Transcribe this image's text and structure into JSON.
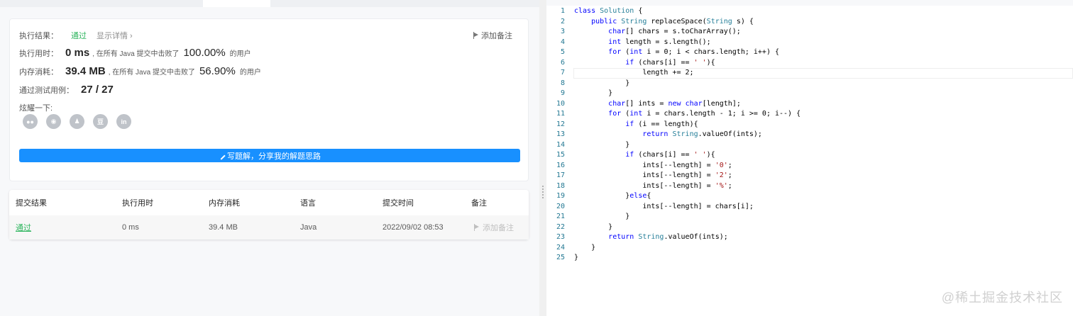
{
  "result": {
    "status_label": "执行结果：",
    "status_value": "通过",
    "show_detail": "显示详情 ›",
    "add_note": "添加备注",
    "runtime_label": "执行用时：",
    "runtime_value": "0 ms",
    "runtime_beat_prefix": ", 在所有 Java 提交中击败了",
    "runtime_pct": "100.00%",
    "users_suffix": "的用户",
    "memory_label": "内存消耗：",
    "memory_value": "39.4 MB",
    "memory_beat_prefix": ", 在所有 Java 提交中击败了",
    "memory_pct": "56.90%",
    "tests_label": "通过测试用例：",
    "tests_value": "27 / 27",
    "share_label": "炫耀一下:",
    "share_icons": [
      "wechat-icon",
      "weibo-icon",
      "qq-icon",
      "douban-icon",
      "linkedin-icon"
    ],
    "write_button": "写题解，分享我的解题思路"
  },
  "table": {
    "headers": [
      "提交结果",
      "执行用时",
      "内存消耗",
      "语言",
      "提交时间",
      "备注"
    ],
    "row": {
      "result": "通过",
      "runtime": "0 ms",
      "memory": "39.4 MB",
      "language": "Java",
      "time": "2022/09/02 08:53",
      "note": "添加备注"
    }
  },
  "code": {
    "lines": [
      {
        "n": "1"
      },
      {
        "n": "2"
      },
      {
        "n": "3"
      },
      {
        "n": "4"
      },
      {
        "n": "5"
      },
      {
        "n": "6"
      },
      {
        "n": "7"
      },
      {
        "n": "8"
      },
      {
        "n": "9"
      },
      {
        "n": "10"
      },
      {
        "n": "11"
      },
      {
        "n": "12"
      },
      {
        "n": "13"
      },
      {
        "n": "14"
      },
      {
        "n": "15"
      },
      {
        "n": "16"
      },
      {
        "n": "17"
      },
      {
        "n": "18"
      },
      {
        "n": "19"
      },
      {
        "n": "20"
      },
      {
        "n": "21"
      },
      {
        "n": "22"
      },
      {
        "n": "23"
      },
      {
        "n": "24"
      },
      {
        "n": "25"
      }
    ]
  },
  "watermark": "@稀土掘金技术社区",
  "colors": {
    "accent": "#1890ff",
    "success": "#2db55d",
    "keyword": "#0000ff",
    "string": "#a31515",
    "type": "#267f99"
  }
}
